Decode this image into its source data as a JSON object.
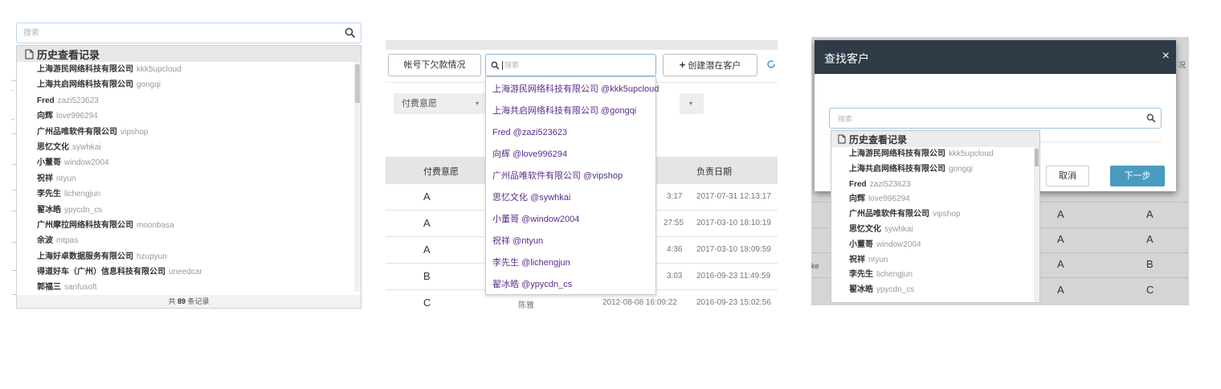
{
  "panel1": {
    "search": {
      "placeholder": "搜索"
    },
    "dropdown": {
      "header": "历史查看记录",
      "items": [
        {
          "name": "上海游民网络科技有限公司",
          "user": "kkk5upcloud"
        },
        {
          "name": "上海共启网络科技有限公司",
          "user": "gongqi"
        },
        {
          "name": "Fred",
          "user": "zazi523623"
        },
        {
          "name": "向辉",
          "user": "love996294"
        },
        {
          "name": "广州品唯软件有限公司",
          "user": "vipshop"
        },
        {
          "name": "思忆文化",
          "user": "sywhkai"
        },
        {
          "name": "小董哥",
          "user": "window2004"
        },
        {
          "name": "祝祥",
          "user": "ntyun"
        },
        {
          "name": "李先生",
          "user": "lichengjun"
        },
        {
          "name": "翟冰皓",
          "user": "ypycdn_cs"
        },
        {
          "name": "广州摩拉网络科技有限公司",
          "user": "moonbasa"
        },
        {
          "name": "余波",
          "user": "mtpas"
        },
        {
          "name": "上海好卓数据服务有限公司",
          "user": "hzupyun"
        },
        {
          "name": "得道好车（广州）信息科技有限公司",
          "user": "uneedcar"
        },
        {
          "name": "郭福三",
          "user": "sanfusoft"
        }
      ],
      "footer": {
        "prefix": "共",
        "count": "89",
        "suffix": "条记录"
      }
    }
  },
  "panel2": {
    "toolbar": {
      "arrears_label": "帐号下欠款情况",
      "search_placeholder": "搜索",
      "create_label": "创建潜在客户",
      "create_plus": "+"
    },
    "filter": {
      "label": "付费意愿",
      "arrow": "▾"
    },
    "table": {
      "headers": {
        "willingness": "付费意愿",
        "debt_date": "负责日期"
      },
      "rows": [
        {
          "level": "A",
          "time": "3:17",
          "date": "2017-07-31 12:13:17"
        },
        {
          "level": "A",
          "time": "27:55",
          "date": "2017-03-10 18:10:19"
        },
        {
          "level": "A",
          "time": "4:36",
          "date": "2017-03-10 18:09:59"
        },
        {
          "level": "B",
          "time": "3:03",
          "date": "2016-09-23 11:49:59"
        },
        {
          "level": "C",
          "owner": "陈雅",
          "time": "2012-08-08 16:09:22",
          "date": "2016-09-23 15:02:56"
        }
      ]
    },
    "suggestions": [
      "上海游民网络科技有限公司 @kkk5upcloud",
      "上海共启网络科技有限公司 @gongqi",
      "Fred @zazi523623",
      "向辉 @love996294",
      "广州品唯软件有限公司 @vipshop",
      "思忆文化 @sywhkai",
      "小董哥 @window2004",
      "祝祥 @ntyun",
      "李先生 @lichengjun",
      "翟冰皓 @ypycdn_cs"
    ]
  },
  "panel3": {
    "modal": {
      "title": "查找客户",
      "close": "×",
      "search_placeholder": "搜索",
      "cancel_label": "取消",
      "next_label": "下一步"
    },
    "dropdown": {
      "header": "历史查看记录",
      "items": [
        {
          "name": "上海游民网络科技有限公司",
          "user": "kkk5upcloud"
        },
        {
          "name": "上海共启网络科技有限公司",
          "user": "gongqi"
        },
        {
          "name": "Fred",
          "user": "zazi523623"
        },
        {
          "name": "向辉",
          "user": "love996294"
        },
        {
          "name": "广州品唯软件有限公司",
          "user": "vipshop"
        },
        {
          "name": "思忆文化",
          "user": "sywhkai"
        },
        {
          "name": "小董哥",
          "user": "window2004"
        },
        {
          "name": "祝祥",
          "user": "ntyun"
        },
        {
          "name": "李先生",
          "user": "lichengjun"
        },
        {
          "name": "翟冰皓",
          "user": "ypycdn_cs"
        }
      ]
    },
    "background": {
      "edge_text_top": "况",
      "edge_text_side": "ke",
      "rows": [
        {
          "c1": "A",
          "c2": "A"
        },
        {
          "c1": "A",
          "c2": "A"
        },
        {
          "c1": "A",
          "c2": "B"
        },
        {
          "c1": "A",
          "c2": "C"
        }
      ]
    }
  }
}
